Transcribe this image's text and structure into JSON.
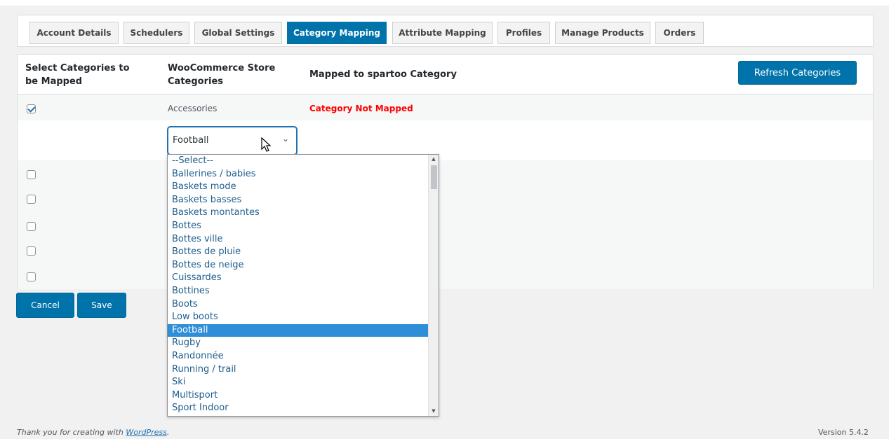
{
  "tabs": [
    {
      "label": "Account Details",
      "active": false
    },
    {
      "label": "Schedulers",
      "active": false
    },
    {
      "label": "Global Settings",
      "active": false
    },
    {
      "label": "Category Mapping",
      "active": true
    },
    {
      "label": "Attribute Mapping",
      "active": false
    },
    {
      "label": "Profiles",
      "active": false
    },
    {
      "label": "Manage Products",
      "active": false
    },
    {
      "label": "Orders",
      "active": false
    }
  ],
  "table": {
    "col_select": "Select Categories to be Mapped",
    "col_store": "WooCommerce Store Categories",
    "col_mapped": "Mapped to spartoo Category",
    "refresh_label": "Refresh Categories",
    "first_row": {
      "category": "Accessories",
      "status": "Category Not Mapped",
      "checked": true
    }
  },
  "select": {
    "value": "Football",
    "options": [
      "--Select--",
      "Ballerines / babies",
      "Baskets mode",
      "Baskets basses",
      "Baskets montantes",
      "Bottes",
      "Bottes ville",
      "Bottes de pluie",
      "Bottes de neige",
      "Cuissardes",
      "Bottines",
      "Boots",
      "Low boots",
      "Football",
      "Rugby",
      "Randonnée",
      "Running / trail",
      "Ski",
      "Multisport",
      "Sport Indoor"
    ],
    "selected_option": "Football"
  },
  "actions": {
    "cancel_label": "Cancel",
    "save_label": "Save"
  },
  "footer": {
    "thanks_prefix": "Thank you for creating with ",
    "thanks_link": "WordPress",
    "thanks_suffix": ".",
    "version": "Version 5.4.2"
  },
  "colors": {
    "primary": "#0073aa",
    "error": "#ff0000",
    "option_highlight": "#2e8fd8"
  }
}
